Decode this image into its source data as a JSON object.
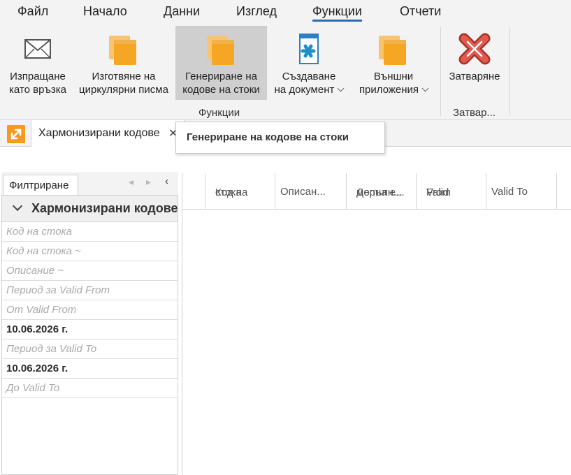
{
  "menu": {
    "items": [
      {
        "label": "Файл",
        "active": false
      },
      {
        "label": "Начало",
        "active": false
      },
      {
        "label": "Данни",
        "active": false
      },
      {
        "label": "Изглед",
        "active": false
      },
      {
        "label": "Функции",
        "active": true
      },
      {
        "label": "Отчети",
        "active": false
      }
    ]
  },
  "ribbon": {
    "buttons": [
      {
        "line1": "Изпращане",
        "line2": "като връзка",
        "icon": "envelope-icon"
      },
      {
        "line1": "Изготвяне на",
        "line2": "циркулярни писма",
        "icon": "folder-icon"
      },
      {
        "line1": "Генериране на",
        "line2": "кодове на стоки",
        "icon": "folder-icon",
        "selected": true
      },
      {
        "line1": "Създаване",
        "line2": "на документ",
        "icon": "new-document-icon",
        "dropdown": true
      },
      {
        "line1": "Външни",
        "line2": "приложения",
        "icon": "folder-icon",
        "dropdown": true
      },
      {
        "line1": "Затваряне",
        "line2": "",
        "icon": "close-red-x-icon"
      }
    ],
    "groups": [
      "Функции",
      "Затвар..."
    ]
  },
  "tabs": {
    "active_label": "Хармонизирани кодове",
    "close_glyph": "✕"
  },
  "tooltip": {
    "text": "Генериране на кодове на стоки"
  },
  "filter": {
    "tab_label": "Филтриране",
    "group_title": "Хармонизирани кодове",
    "rows": [
      {
        "text": "Код на стока",
        "kind": "placeholder"
      },
      {
        "text": "Код на стока ~",
        "kind": "placeholder"
      },
      {
        "text": "Описание ~",
        "kind": "placeholder"
      },
      {
        "text": "Период за Valid From",
        "kind": "placeholder"
      },
      {
        "text": "От Valid From",
        "kind": "placeholder"
      },
      {
        "text": "10.06.2026 г.",
        "kind": "value"
      },
      {
        "text": "Период за Valid To",
        "kind": "placeholder"
      },
      {
        "text": "10.06.2026 г.",
        "kind": "value"
      },
      {
        "text": "До Valid To",
        "kind": "placeholder"
      }
    ]
  },
  "grid": {
    "columns": [
      {
        "line1": "",
        "line2": ""
      },
      {
        "line1": "Код на",
        "line2": "стока"
      },
      {
        "line1": "Описан...",
        "line2": ""
      },
      {
        "line1": "Допълн...",
        "line2": "мерна е..."
      },
      {
        "line1": "Valid",
        "line2": "From"
      },
      {
        "line1": "Valid To",
        "line2": ""
      }
    ]
  },
  "colors": {
    "accent_blue": "#2b6cb0",
    "folder_orange": "#f5a623",
    "close_red": "#c0392b",
    "asterisk_blue": "#1e90c8"
  }
}
